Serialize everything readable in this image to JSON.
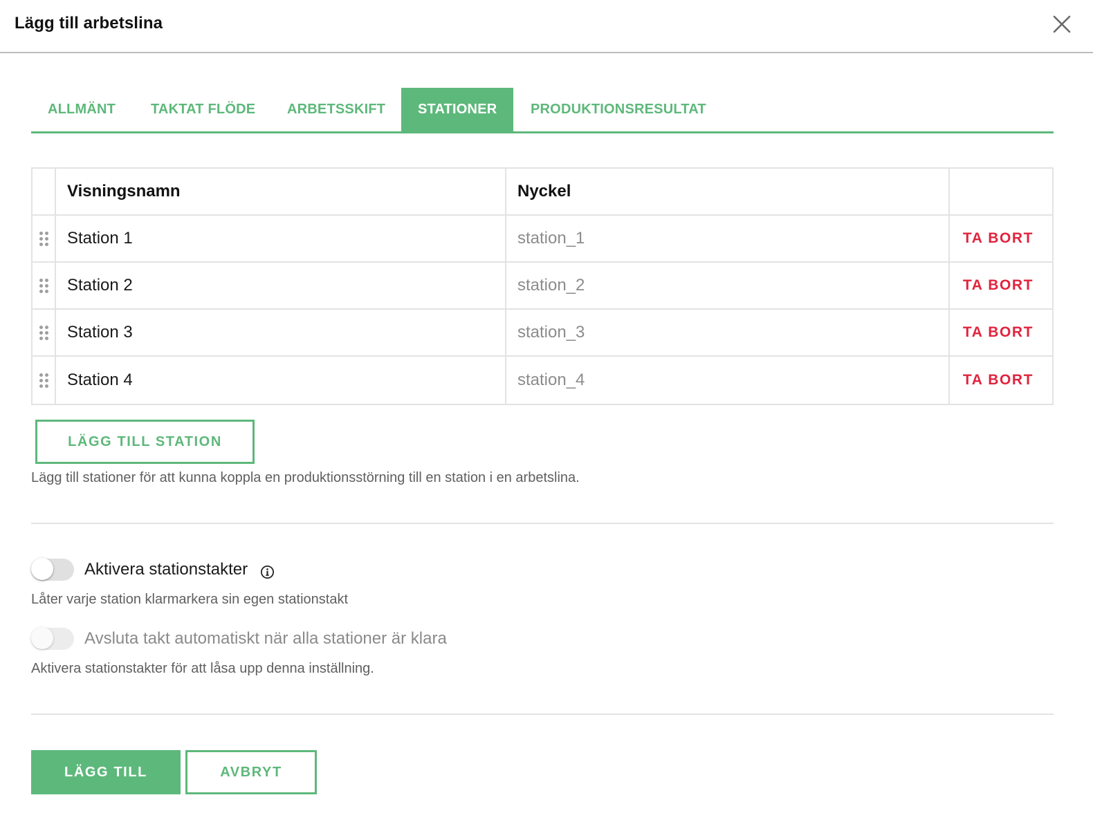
{
  "dialog": {
    "title": "Lägg till arbetslina",
    "close_icon": "close-icon"
  },
  "tabs": [
    {
      "label": "ALLMÄNT",
      "active": false
    },
    {
      "label": "TAKTAT FLÖDE",
      "active": false
    },
    {
      "label": "ARBETSSKIFT",
      "active": false
    },
    {
      "label": "STATIONER",
      "active": true
    },
    {
      "label": "PRODUKTIONSRESULTAT",
      "active": false
    }
  ],
  "stations_table": {
    "headers": {
      "name": "Visningsnamn",
      "key": "Nyckel"
    },
    "rows": [
      {
        "name": "Station 1",
        "key": "station_1",
        "action": "TA BORT"
      },
      {
        "name": "Station 2",
        "key": "station_2",
        "action": "TA BORT"
      },
      {
        "name": "Station 3",
        "key": "station_3",
        "action": "TA BORT"
      },
      {
        "name": "Station 4",
        "key": "station_4",
        "action": "TA BORT"
      }
    ]
  },
  "add_station": {
    "label": "LÄGG TILL STATION",
    "helper": "Lägg till stationer för att kunna koppla en produktionsstörning till en station i en arbetslina."
  },
  "station_takts": {
    "label": "Aktivera stationstakter",
    "enabled": false,
    "helper": "Låter varje station klarmarkera sin egen stationstakt",
    "info_icon": "info-icon"
  },
  "auto_finish": {
    "label": "Avsluta takt automatiskt när alla stationer är klara",
    "enabled": false,
    "disabled": true,
    "helper": "Aktivera stationstakter för att låsa upp denna inställning."
  },
  "footer": {
    "submit_label": "LÄGG TILL",
    "cancel_label": "AVBRYT"
  },
  "colors": {
    "accent": "#5db87b",
    "danger": "#e0243e",
    "border": "#e3e3e3"
  }
}
